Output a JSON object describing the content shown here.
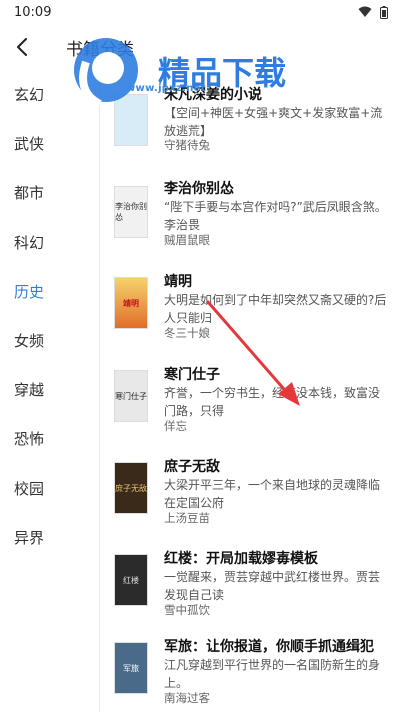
{
  "status_bar": {
    "time": "10:09"
  },
  "header": {
    "title": "书籍分类"
  },
  "watermark": {
    "logo_text": "精品下载",
    "url_text": "www.jpxz.net"
  },
  "categories": [
    "玄幻",
    "武侠",
    "都市",
    "科幻",
    "历史",
    "女频",
    "穿越",
    "恐怖",
    "校园",
    "异界"
  ],
  "active_category": "历史",
  "books": [
    {
      "title": "宋凡深姜的小说",
      "desc": "【空间+神医+女强+爽文+发家致富+流放逃荒】",
      "author": "守猪待兔",
      "cover_text": ""
    },
    {
      "title": "李治你别怂",
      "desc": "“陛下手要与本宫作对吗?”武后凤眼含煞。李治畏",
      "author": "贼眉鼠眼",
      "cover_text": "李治你别怂"
    },
    {
      "title": "靖明",
      "desc": "大明是如何到了中年却突然又斋又硬的?后人只能归",
      "author": "冬三十娘",
      "cover_text": "靖明"
    },
    {
      "title": "寒门仕子",
      "desc": "齐誉，一个穷书生，经商没本钱，致富没门路，只得",
      "author": "佯忘",
      "cover_text": "寒门仕子"
    },
    {
      "title": "庶子无敌",
      "desc": "大梁开平三年，一个来自地球的灵魂降临在定国公府",
      "author": "上汤豆苗",
      "cover_text": "庶子无敌"
    },
    {
      "title": "红楼：开局加载嫪毐模板",
      "desc": "一觉醒来，贾芸穿越中武红楼世界。贾芸发现自己读",
      "author": "雪中孤饮",
      "cover_text": "红楼"
    },
    {
      "title": "军旅：让你报道，你顺手抓通缉犯",
      "desc": "江凡穿越到平行世界的一名国防新生的身上。",
      "author": "南海过客",
      "cover_text": "军旅"
    }
  ],
  "colors": {
    "active": "#2f7de1",
    "arrow": "#e5383b",
    "watermark_blue": "#2f7de1"
  }
}
